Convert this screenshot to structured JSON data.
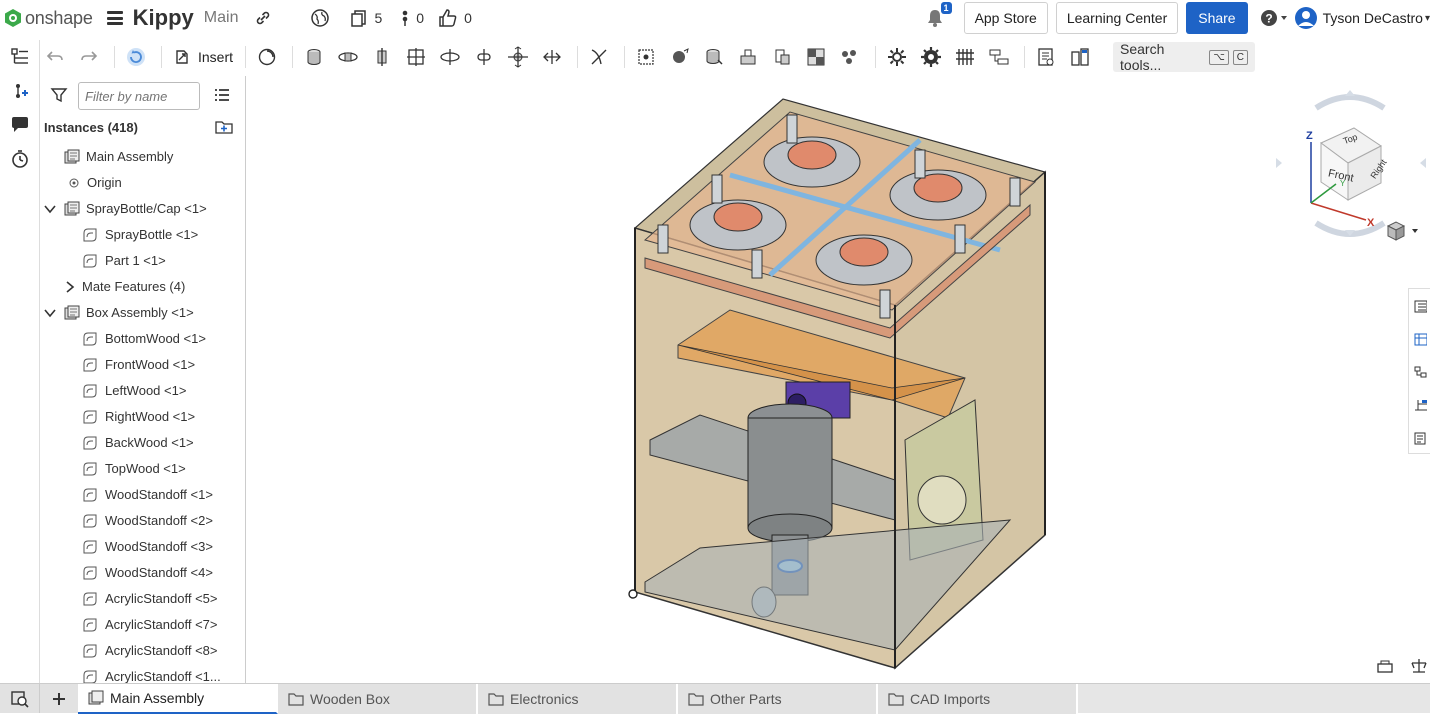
{
  "topbar": {
    "brand": "onshape",
    "doc_title": "Kippy",
    "branch": "Main",
    "versions_count": "5",
    "branches_count": "0",
    "likes_count": "0",
    "notifications_badge": "1",
    "app_store": "App Store",
    "learning_center": "Learning Center",
    "share": "Share",
    "user_name": "Tyson DeCastro",
    "brand_color": "#1e63c6"
  },
  "toolbar": {
    "insert_label": "Insert",
    "search_label": "Search tools...",
    "shortcut_key1": "⌥",
    "shortcut_key2": "C"
  },
  "panel": {
    "filter_placeholder": "Filter by name",
    "instances_label": "Instances (418)",
    "tree": [
      {
        "label": "Main Assembly",
        "indent": 0,
        "icon": "assembly",
        "chev": ""
      },
      {
        "label": "Origin",
        "indent": 1,
        "icon": "origin",
        "chev": ""
      },
      {
        "label": "SprayBottle/Cap <1>",
        "indent": 0,
        "icon": "assembly",
        "chev": "down"
      },
      {
        "label": "SprayBottle <1>",
        "indent": 2,
        "icon": "part",
        "chev": ""
      },
      {
        "label": "Part 1 <1>",
        "indent": 2,
        "icon": "part",
        "chev": ""
      },
      {
        "label": "Mate Features (4)",
        "indent": 1,
        "icon": "none",
        "chev": "right"
      },
      {
        "label": "Box Assembly <1>",
        "indent": 0,
        "icon": "assembly",
        "chev": "down"
      },
      {
        "label": "BottomWood <1>",
        "indent": 2,
        "icon": "part",
        "chev": ""
      },
      {
        "label": "FrontWood <1>",
        "indent": 2,
        "icon": "part",
        "chev": ""
      },
      {
        "label": "LeftWood <1>",
        "indent": 2,
        "icon": "part",
        "chev": ""
      },
      {
        "label": "RightWood <1>",
        "indent": 2,
        "icon": "part",
        "chev": ""
      },
      {
        "label": "BackWood <1>",
        "indent": 2,
        "icon": "part",
        "chev": ""
      },
      {
        "label": "TopWood <1>",
        "indent": 2,
        "icon": "part",
        "chev": ""
      },
      {
        "label": "WoodStandoff <1>",
        "indent": 2,
        "icon": "part",
        "chev": ""
      },
      {
        "label": "WoodStandoff <2>",
        "indent": 2,
        "icon": "part",
        "chev": ""
      },
      {
        "label": "WoodStandoff <3>",
        "indent": 2,
        "icon": "part",
        "chev": ""
      },
      {
        "label": "WoodStandoff <4>",
        "indent": 2,
        "icon": "part",
        "chev": ""
      },
      {
        "label": "AcrylicStandoff <5>",
        "indent": 2,
        "icon": "part",
        "chev": ""
      },
      {
        "label": "AcrylicStandoff <7>",
        "indent": 2,
        "icon": "part",
        "chev": ""
      },
      {
        "label": "AcrylicStandoff <8>",
        "indent": 2,
        "icon": "part",
        "chev": ""
      },
      {
        "label": "AcrylicStandoff <1...",
        "indent": 2,
        "icon": "part",
        "chev": ""
      }
    ]
  },
  "viewcube": {
    "top": "Top",
    "front": "Front",
    "right": "Right",
    "axis_z": "Z",
    "axis_x": "X",
    "axis_y": "Y"
  },
  "tabs": [
    {
      "label": "Main Assembly",
      "active": true,
      "icon": "assembly"
    },
    {
      "label": "Wooden Box",
      "active": false,
      "icon": "folder"
    },
    {
      "label": "Electronics",
      "active": false,
      "icon": "folder"
    },
    {
      "label": "Other Parts",
      "active": false,
      "icon": "folder"
    },
    {
      "label": "CAD Imports",
      "active": false,
      "icon": "folder"
    }
  ]
}
